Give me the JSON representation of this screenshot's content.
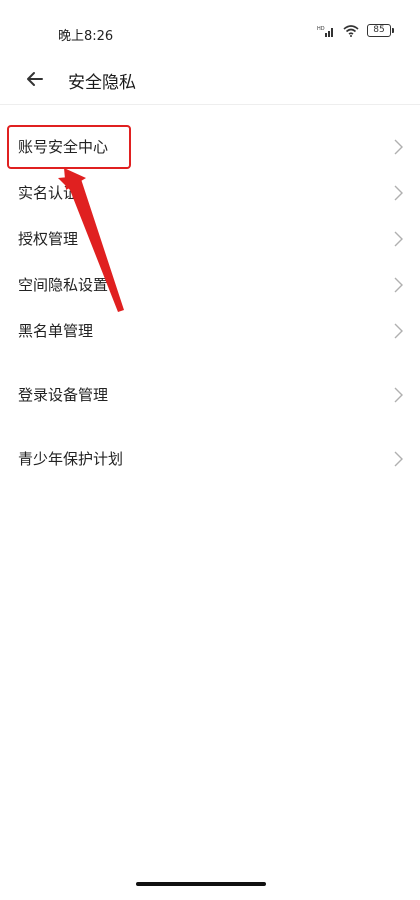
{
  "status_bar": {
    "time": "晚上8:26",
    "battery": "85"
  },
  "header": {
    "title": "安全隐私",
    "back_icon": "back-arrow-icon"
  },
  "menu": {
    "items": [
      {
        "label": "账号安全中心"
      },
      {
        "label": "实名认证"
      },
      {
        "label": "授权管理"
      },
      {
        "label": "空间隐私设置"
      },
      {
        "label": "黑名单管理"
      },
      {
        "label": "登录设备管理"
      },
      {
        "label": "青少年保护计划"
      }
    ]
  },
  "annotation": {
    "highlight_color": "#e02020"
  },
  "colors": {
    "text": "#222222",
    "chevron": "#b0b0b0",
    "divider": "#eeeeee"
  }
}
